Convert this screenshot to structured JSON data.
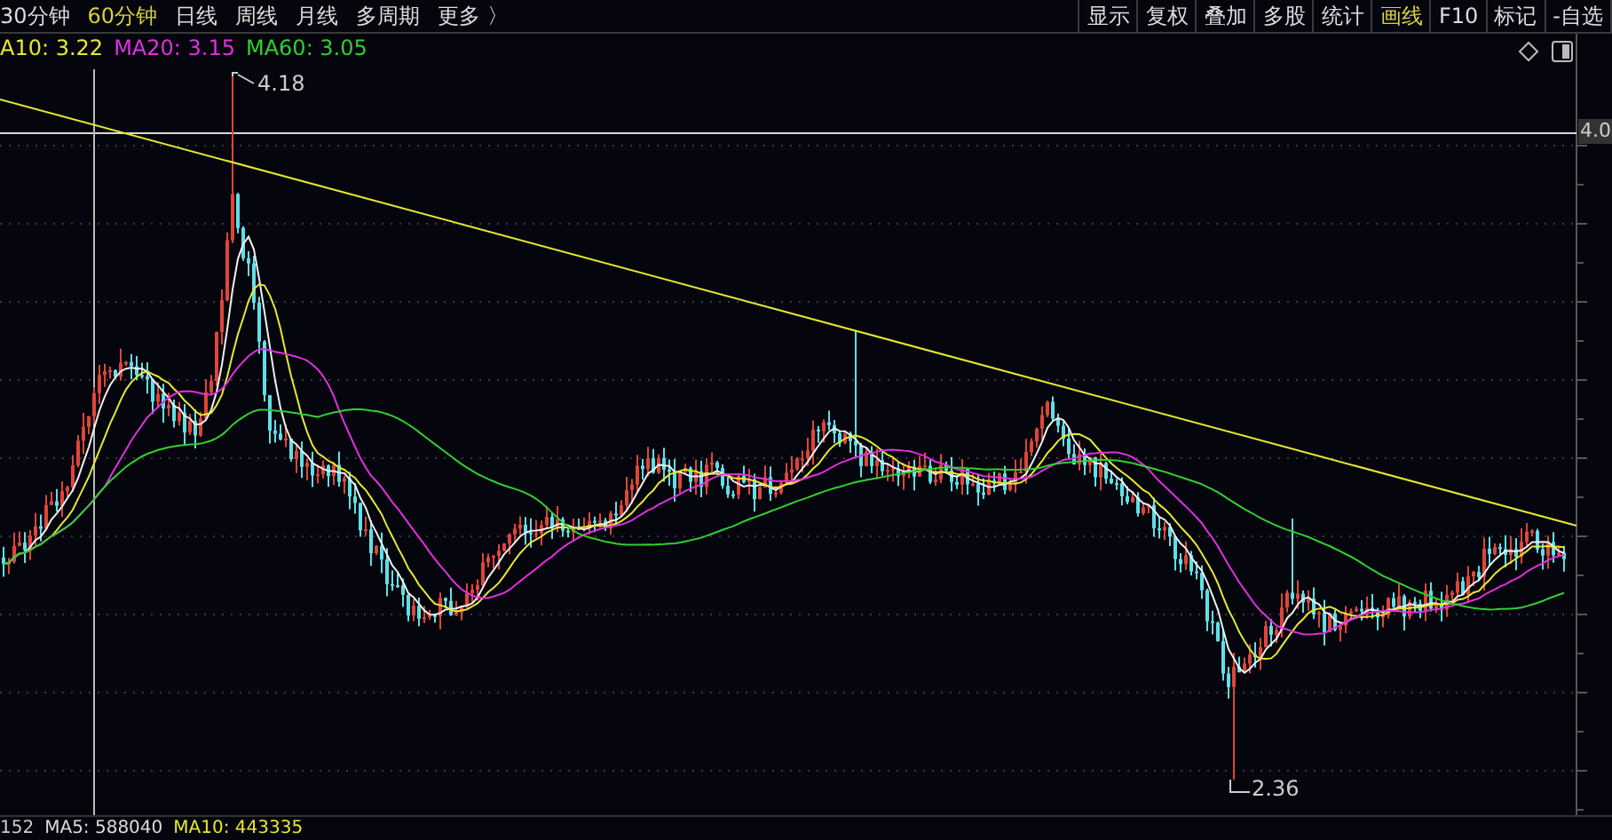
{
  "period_tabs": [
    {
      "label": "30分钟",
      "selected": false
    },
    {
      "label": "60分钟",
      "selected": true
    },
    {
      "label": "日线",
      "selected": false
    },
    {
      "label": "周线",
      "selected": false
    },
    {
      "label": "月线",
      "selected": false
    },
    {
      "label": "多周期",
      "selected": false
    },
    {
      "label": "更多 〉",
      "selected": false
    }
  ],
  "toolbar": [
    {
      "label": "显示",
      "selected": false
    },
    {
      "label": "复权",
      "selected": false
    },
    {
      "label": "叠加",
      "selected": false
    },
    {
      "label": "多股",
      "selected": false
    },
    {
      "label": "统计",
      "selected": false
    },
    {
      "label": "画线",
      "selected": true
    },
    {
      "label": "F10",
      "selected": false
    },
    {
      "label": "标记",
      "selected": false
    },
    {
      "label": "-自选",
      "selected": false
    }
  ],
  "ma_legend": [
    {
      "label": "A10: 3.22",
      "color": "#e8e830"
    },
    {
      "label": "MA20: 3.15",
      "color": "#e030e0"
    },
    {
      "label": "MA60: 3.05",
      "color": "#30d030"
    }
  ],
  "chart": {
    "high_label": "4.18",
    "low_label": "2.36",
    "axis_label": "4.0"
  },
  "volume_legend": [
    {
      "label": "152",
      "color": "#cccccc"
    },
    {
      "label": "MA5: 588040",
      "color": "#dddddd"
    },
    {
      "label": "MA10: 443335",
      "color": "#e8e830"
    }
  ]
}
